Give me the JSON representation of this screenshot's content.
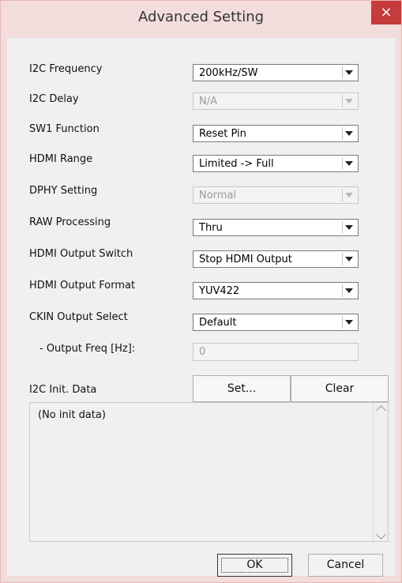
{
  "window": {
    "title": "Advanced Setting",
    "close_glyph": "×"
  },
  "fields": [
    {
      "label": "I2C Frequency",
      "value": "200kHz/SW",
      "enabled": true
    },
    {
      "label": "I2C Delay",
      "value": "N/A",
      "enabled": false
    },
    {
      "label": "SW1 Function",
      "value": "Reset Pin",
      "enabled": true
    },
    {
      "label": "HDMI Range",
      "value": "Limited -> Full",
      "enabled": true
    },
    {
      "label": "DPHY Setting",
      "value": "Normal",
      "enabled": false
    },
    {
      "label": "RAW Processing",
      "value": "Thru",
      "enabled": true
    },
    {
      "label": "HDMI Output Switch",
      "value": "Stop HDMI Output",
      "enabled": true
    },
    {
      "label": "HDMI Output Format",
      "value": "YUV422",
      "enabled": true
    },
    {
      "label": "CKIN Output Select",
      "value": "Default",
      "enabled": true
    }
  ],
  "output_freq": {
    "label": "- Output Freq [Hz]:",
    "value": "0"
  },
  "init_data": {
    "label": "I2C Init. Data",
    "set_label": "Set...",
    "clear_label": "Clear",
    "content": "(No init data)"
  },
  "footer": {
    "ok_label": "OK",
    "cancel_label": "Cancel"
  }
}
